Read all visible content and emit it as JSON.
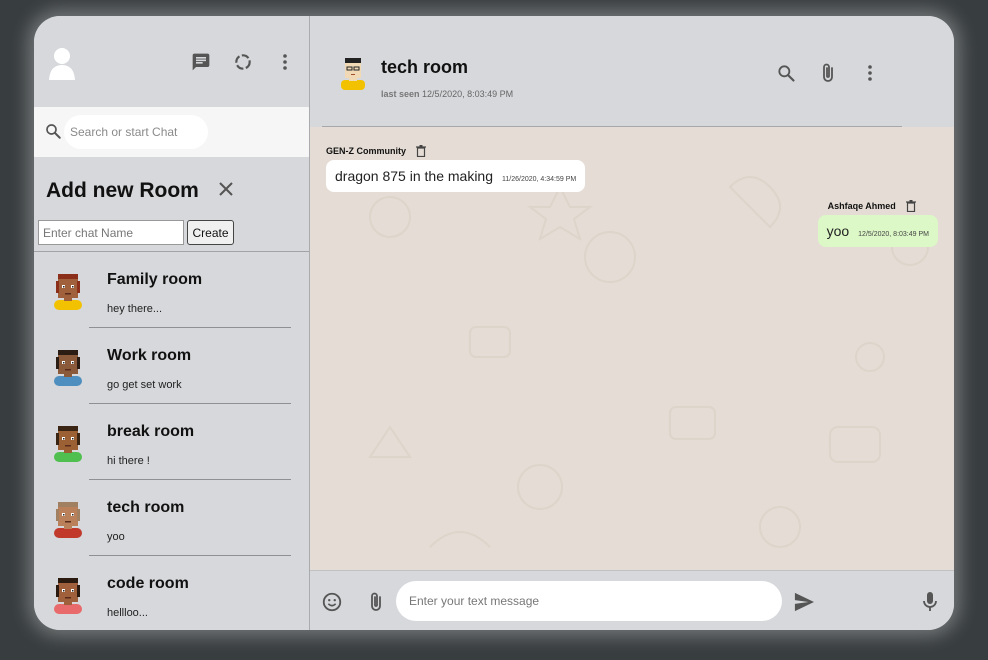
{
  "sidebar": {
    "search": {
      "placeholder": "Search or start Chat",
      "value": ""
    },
    "add_room": {
      "title": "Add new Room",
      "input_placeholder": "Enter chat Name",
      "create_label": "Create"
    },
    "rooms": [
      {
        "name": "Family room",
        "last": "hey there...",
        "skin": "#a0603c",
        "hair": "#8b2f1a",
        "shirt": "#f2c200"
      },
      {
        "name": "Work room",
        "last": "go get set work",
        "skin": "#8a5a3a",
        "hair": "#2b1d14",
        "shirt": "#4f8fbf"
      },
      {
        "name": "break room",
        "last": "hi there !",
        "skin": "#9b6134",
        "hair": "#3a2414",
        "shirt": "#4fbf4f"
      },
      {
        "name": "tech room",
        "last": "yoo",
        "skin": "#b9805a",
        "hair": "#a08060",
        "shirt": "#c0392b"
      },
      {
        "name": "code room",
        "last": "hellloo...",
        "skin": "#a0603c",
        "hair": "#2b1a10",
        "shirt": "#e86a6a"
      }
    ]
  },
  "chat": {
    "title": "tech room",
    "last_seen_label": "last seen",
    "last_seen_time": "12/5/2020, 8:03:49 PM",
    "messages": [
      {
        "sender": "GEN-Z Community",
        "text": "dragon 875 in the making",
        "time": "11/26/2020, 4:34:59 PM",
        "type": "received"
      },
      {
        "sender": "Ashfaqe Ahmed",
        "text": "yoo",
        "time": "12/5/2020, 8:03:49 PM",
        "type": "sent"
      }
    ],
    "input_placeholder": "Enter your text message"
  },
  "colors": {
    "sent_bubble": "#dcf8c6",
    "received_bubble": "#ffffff",
    "chat_background": "#e5ddd5",
    "panel": "#d6d8db"
  },
  "icons": {
    "header": [
      "chat-icon",
      "status-icon",
      "more-vert-icon"
    ],
    "chat_header": [
      "search-icon",
      "attach-icon",
      "more-vert-icon"
    ],
    "footer": [
      "emoji-icon",
      "attach-icon",
      "send-icon",
      "mic-icon"
    ],
    "message": [
      "trash-icon"
    ]
  }
}
